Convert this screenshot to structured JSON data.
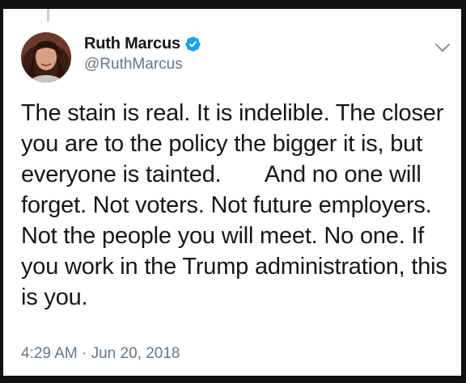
{
  "tweet": {
    "author": {
      "display_name": "Ruth Marcus",
      "handle": "@RuthMarcus",
      "verified": true
    },
    "text": "The stain is real. It is indelible. The closer you are to the policy the bigger it is, but everyone is tainted.       And no one will forget. Not voters. Not future employers. Not the people you will meet. No one. If you work in the Trump administration, this is you.",
    "timestamp": "4:29 AM · Jun 20, 2018"
  },
  "icons": {
    "verified": "verified-badge-icon",
    "menu": "chevron-down-icon",
    "avatar": "avatar"
  },
  "colors": {
    "text_primary": "#14171a",
    "text_secondary": "#657786",
    "verified_blue": "#1da1f2",
    "frame": "#111111",
    "card": "#ffffff",
    "thread_line": "#c7cdd2"
  }
}
